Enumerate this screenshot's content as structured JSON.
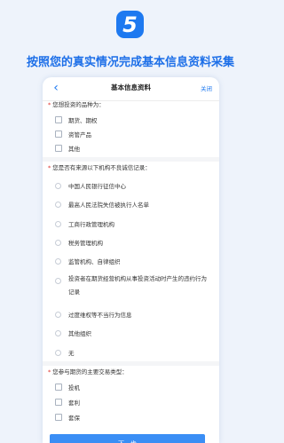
{
  "step": {
    "number": "5"
  },
  "headline": "按照您的真实情况完成基本信息资料采集",
  "nav": {
    "back": "‹",
    "title": "基本信息资料",
    "close": "关闭"
  },
  "sections": [
    {
      "title": "您想投资的品种为：",
      "options": [
        "期货、期权",
        "资管产品",
        "其他"
      ]
    },
    {
      "title": "您是否有来源以下机构不良诚信记录：",
      "options": [
        "中国人民银行征信中心",
        "最高人民法院失信被执行人名单",
        "工商行政管理机构",
        "税务管理机构",
        "监管机构、自律组织",
        "投资者在期货经营机构从事投资活动时产生的违约行为记录",
        "过度维权等不当行为信息",
        "其他组织",
        "无"
      ]
    },
    {
      "title": "您参与期货的主要交易类型：",
      "options": [
        "投机",
        "套利",
        "套保"
      ]
    }
  ],
  "required_mark": "*",
  "next_button": "下一步",
  "colors": {
    "accent": "#1e79f0",
    "button": "#3a8ef5",
    "required": "#e0302c"
  }
}
